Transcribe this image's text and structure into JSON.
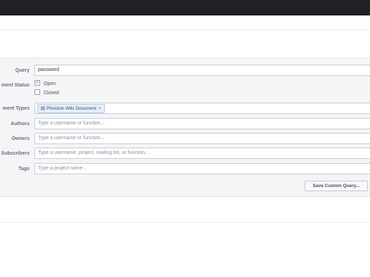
{
  "form": {
    "query": {
      "label": "Query",
      "value": "password"
    },
    "status": {
      "label": "ment Status",
      "options": [
        {
          "label": "Open",
          "checked": true
        },
        {
          "label": "Closed",
          "checked": false
        }
      ]
    },
    "document_types": {
      "label": "ment Types",
      "token": "Phriction Wiki Document",
      "token_icon": "document-icon",
      "token_remove": "×"
    },
    "authors": {
      "label": "Authors",
      "placeholder": "Type a username or function..."
    },
    "owners": {
      "label": "Owners",
      "placeholder": "Type a username or function..."
    },
    "subscribers": {
      "label": "Subscribers",
      "placeholder": "Type a username, project, mailing list, or function..."
    },
    "tags": {
      "label": "Tags",
      "placeholder": "Type a project name..."
    },
    "save_button": "Save Custom Query..."
  },
  "colors": {
    "topbar": "#1f2124",
    "panel": "#f4f5f7",
    "token_bg": "#e6eef9"
  }
}
